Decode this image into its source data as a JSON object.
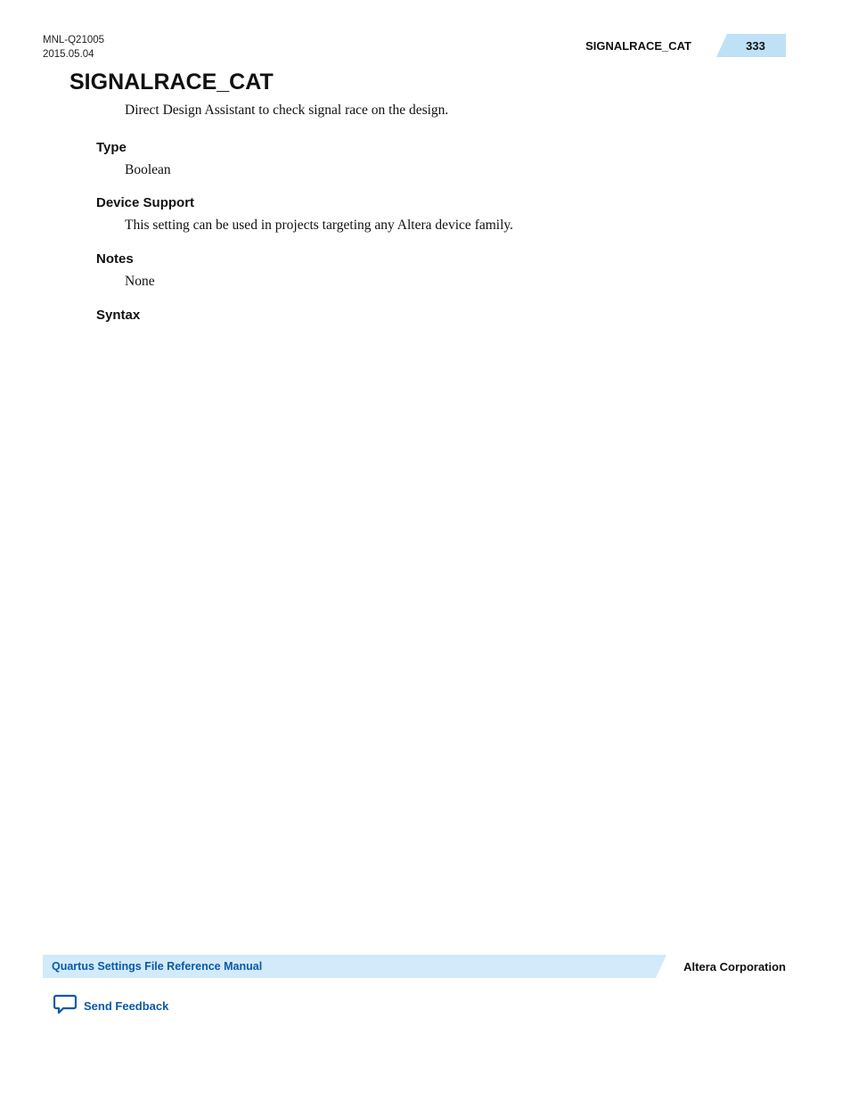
{
  "header": {
    "doc_id": "MNL-Q21005",
    "date": "2015.05.04",
    "section": "SIGNALRACE_CAT",
    "page": "333"
  },
  "title": "SIGNALRACE_CAT",
  "description": "Direct Design Assistant to check signal race on the design.",
  "sections": {
    "type": {
      "heading": "Type",
      "body": "Boolean"
    },
    "device_support": {
      "heading": "Device Support",
      "body": "This setting can be used in projects targeting any Altera device family."
    },
    "notes": {
      "heading": "Notes",
      "body": "None"
    },
    "syntax": {
      "heading": "Syntax",
      "body": ""
    }
  },
  "footer": {
    "manual": "Quartus Settings File Reference Manual",
    "company": "Altera Corporation",
    "feedback": "Send Feedback"
  }
}
